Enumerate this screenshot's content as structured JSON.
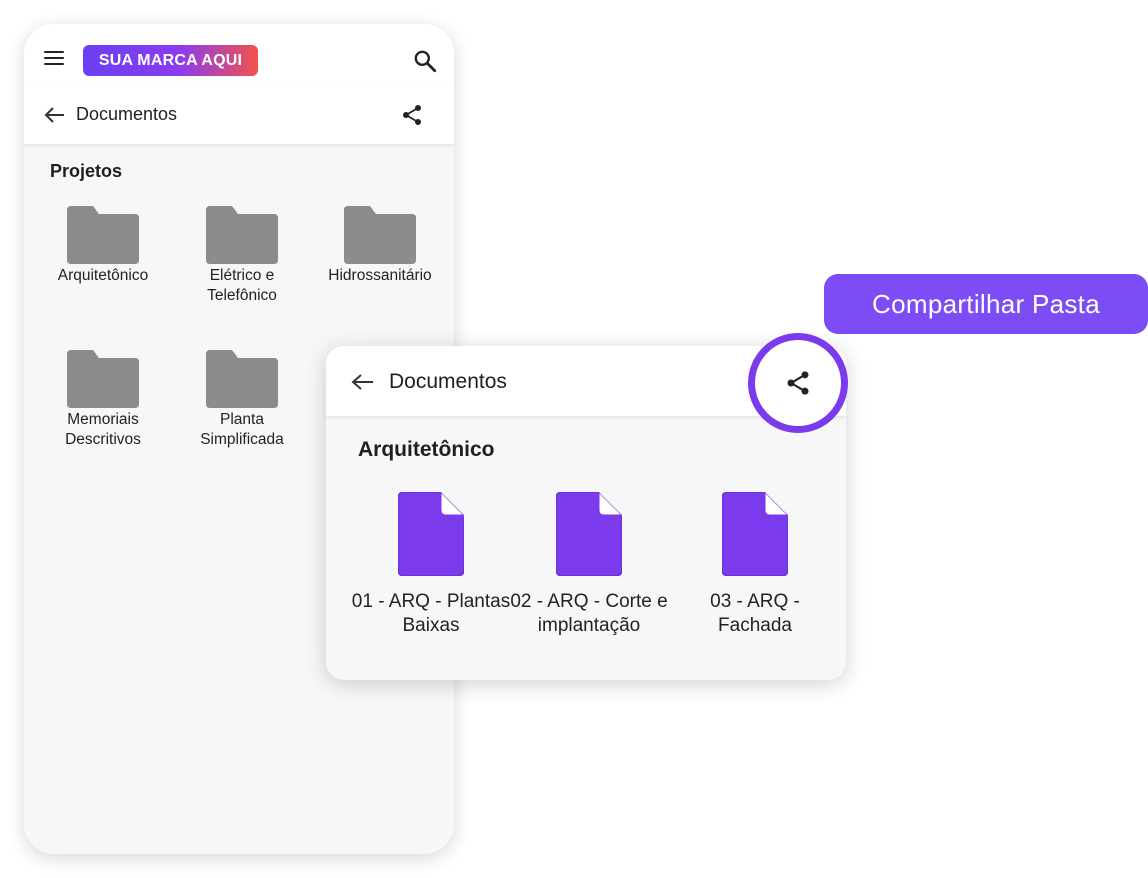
{
  "app": {
    "brand_label": "SUA MARCA AQUI",
    "icons": {
      "menu": "hamburger-icon",
      "search": "search-icon",
      "back": "arrow-left-icon",
      "share": "share-icon",
      "folder": "folder-icon",
      "file": "document-icon"
    }
  },
  "breadcrumb": {
    "title": "Documentos"
  },
  "projects": {
    "section_title": "Projetos",
    "folders": [
      {
        "line1": "Arquitetônico",
        "line2": ""
      },
      {
        "line1": "Elétrico e",
        "line2": "Telefônico"
      },
      {
        "line1": "Hidrossanitário",
        "line2": ""
      },
      {
        "line1": "Memoriais",
        "line2": "Descritivos"
      },
      {
        "line1": "Planta",
        "line2": "Simplificada"
      }
    ]
  },
  "popup": {
    "title": "Documentos",
    "section_title": "Arquitetônico",
    "files": [
      {
        "line1": "01 - ARQ - Plantas",
        "line2": "Baixas"
      },
      {
        "line1": "02 - ARQ - Corte e",
        "line2": "implantação"
      },
      {
        "line1": "03 - ARQ -",
        "line2": "Fachada"
      }
    ]
  },
  "callout": {
    "label": "Compartilhar Pasta"
  },
  "colors": {
    "accent": "#7c3aed",
    "pill": "#7c4df5",
    "folder": "#8c8c8c",
    "file": "#7c3aed",
    "background": "#f6f7f9"
  }
}
